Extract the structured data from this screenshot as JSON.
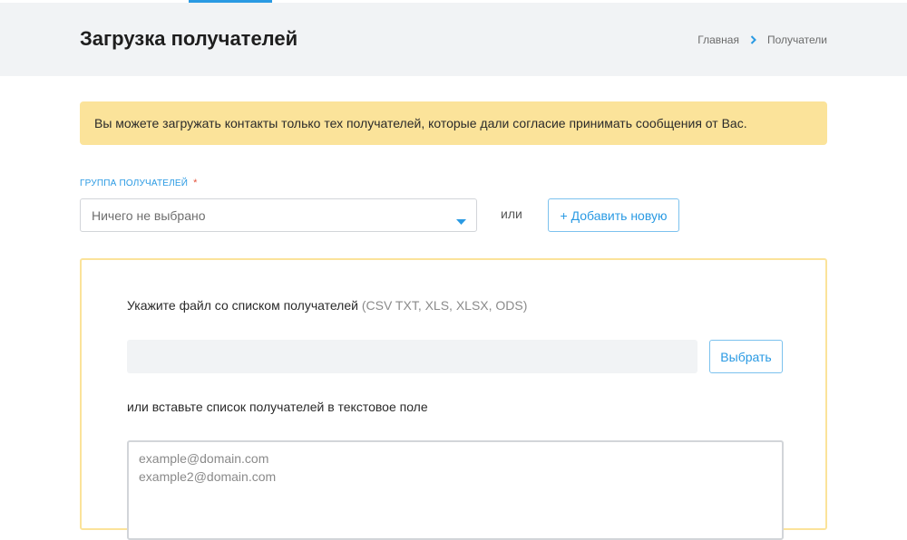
{
  "header": {
    "title": "Загрузка получателей",
    "breadcrumb": {
      "home": "Главная",
      "current": "Получатели"
    }
  },
  "notice": "Вы можете загружать контакты только тех получателей, которые дали согласие принимать сообщения от Вас.",
  "group": {
    "label": "Группа получателей",
    "required_mark": "*",
    "select_value": "Ничего не выбрано",
    "or_text": "или",
    "add_button": "+ Добавить новую"
  },
  "upload": {
    "file_prompt": "Укажите файл со списком получателей",
    "file_formats": "(CSV TXT, XLS, XLSX, ODS)",
    "choose_button": "Выбрать",
    "paste_prompt": "или вставьте список получателей в текстовое поле",
    "placeholder_lines": [
      "example@domain.com",
      "example2@domain.com"
    ]
  },
  "icons": {
    "breadcrumb_separator": "chevron-right-icon",
    "select_caret": "caret-down-icon"
  },
  "colors": {
    "accent": "#2a9ae3",
    "notice_bg": "#fbe39a",
    "header_bg": "#f1f3f5",
    "required": "#e5533c"
  }
}
